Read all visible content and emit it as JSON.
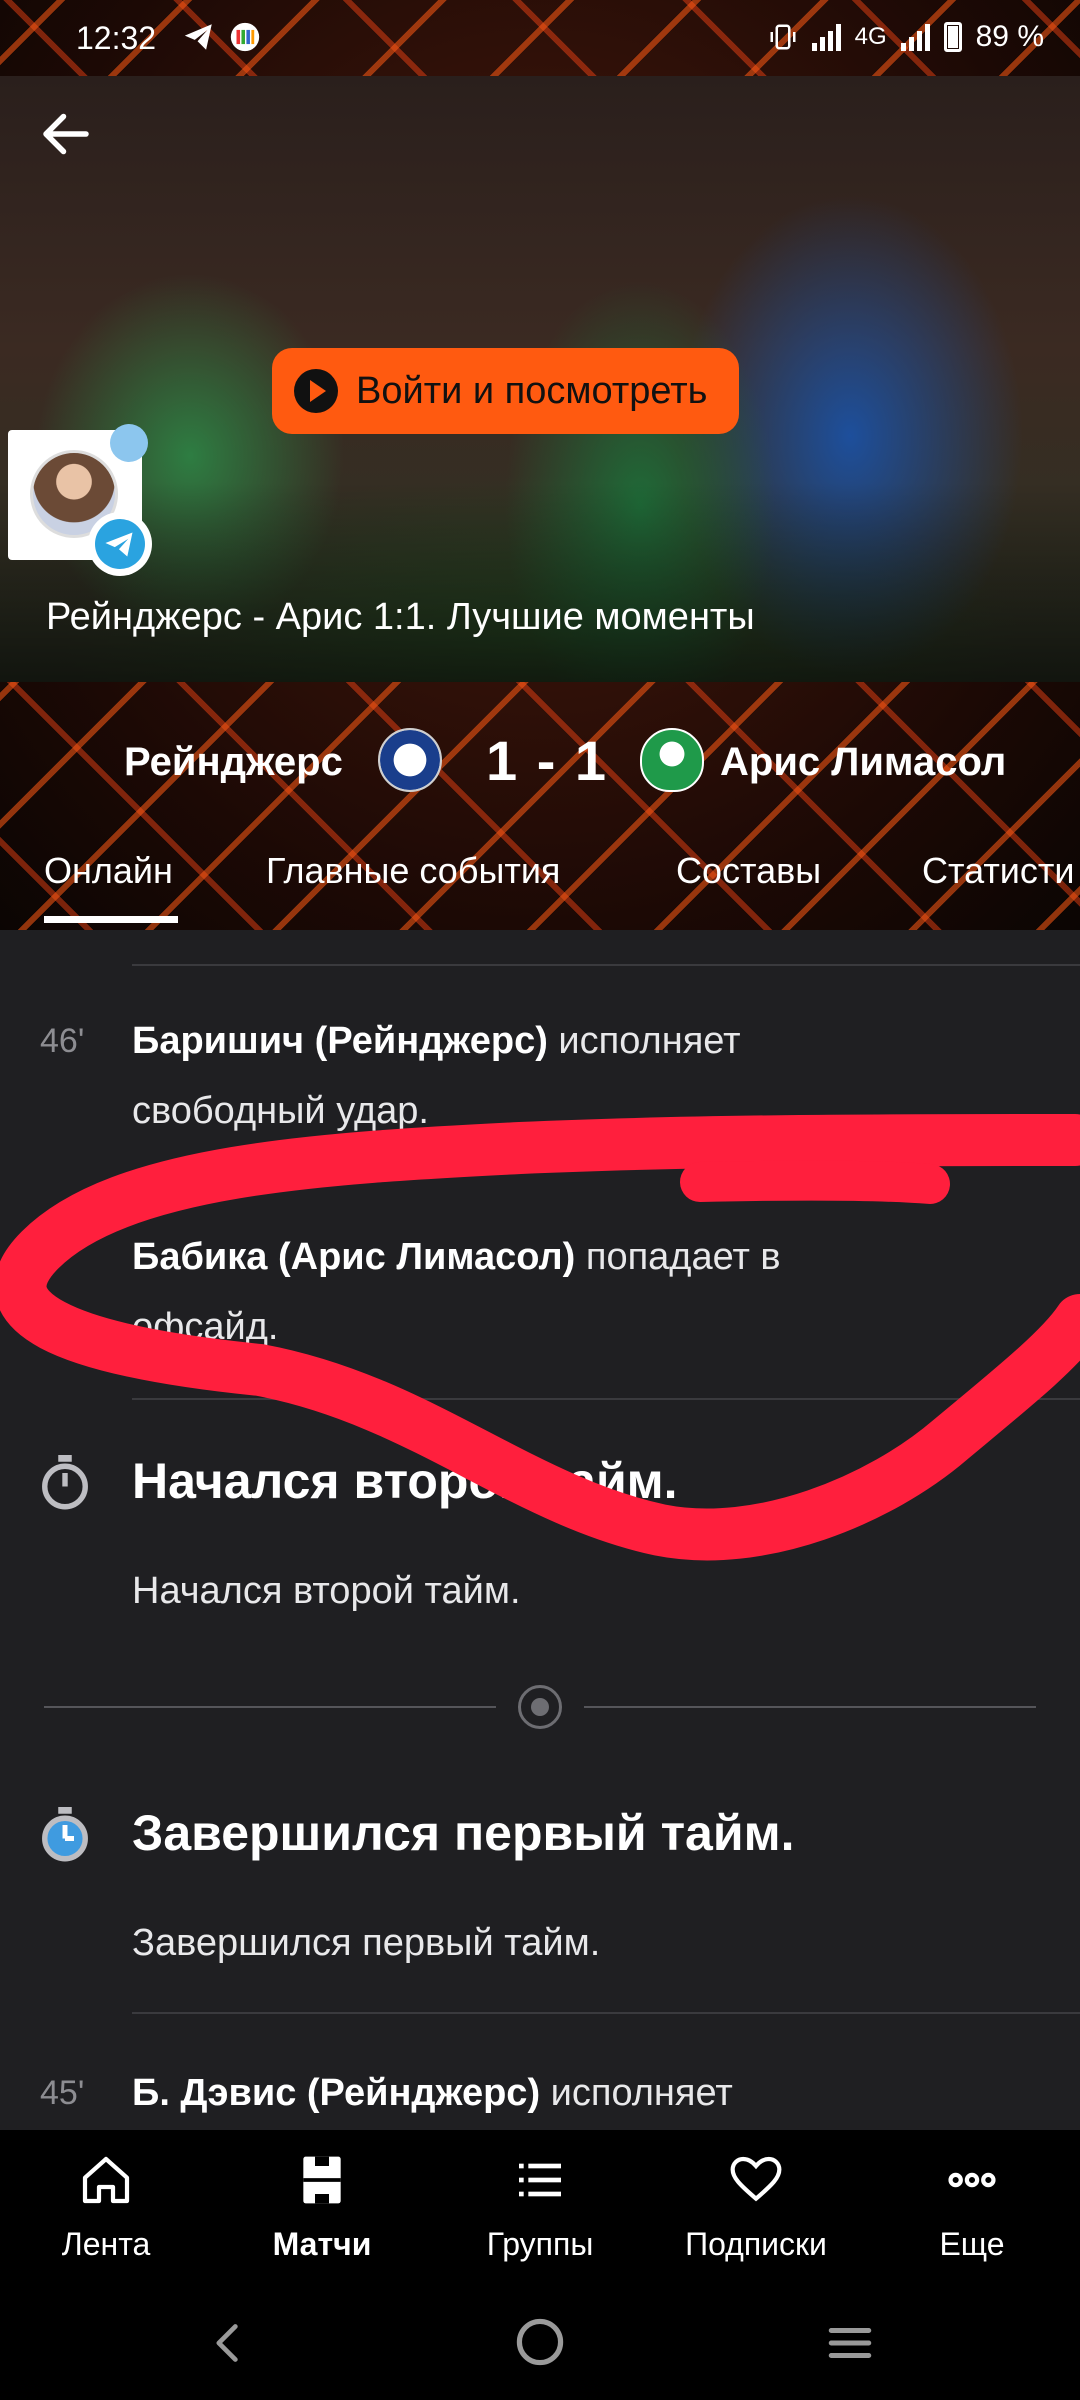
{
  "status_bar": {
    "time": "12:32",
    "network": "4G",
    "battery": "89 %"
  },
  "video": {
    "watch_button": "Войти и посмотреть",
    "title": "Рейнджерс - Арис 1:1. Лучшие моменты"
  },
  "match": {
    "home_team": "Рейнджерс",
    "away_team": "Арис Лимасол",
    "score": "1 - 1"
  },
  "tabs": [
    "Онлайн",
    "Главные события",
    "Составы",
    "Статисти"
  ],
  "feed": {
    "event1": {
      "minute": "46'",
      "player": "Баришич (Рейнджерс)",
      "text_line1_rest": " исполняет",
      "text_line2": "свободный удар."
    },
    "event2": {
      "player": "Бабика (Арис Лимасол)",
      "text_line1_rest": " попадает в",
      "text_line2": "офсайд."
    },
    "event3": {
      "title": "Начался второй тайм.",
      "sub": "Начался второй тайм."
    },
    "event4": {
      "title": "Завершился первый тайм.",
      "sub": "Завершился первый тайм."
    },
    "event5": {
      "minute": "45'",
      "player": "Б. Дэвис (Рейнджерс)",
      "text_line1_rest": " исполняет"
    }
  },
  "bottom_nav": {
    "feed": "Лента",
    "matches": "Матчи",
    "groups": "Группы",
    "subscriptions": "Подписки",
    "more": "Еще"
  },
  "colors": {
    "accent": "#ff5a10",
    "background": "#1f1f22",
    "scribble": "#ff1f3d"
  }
}
